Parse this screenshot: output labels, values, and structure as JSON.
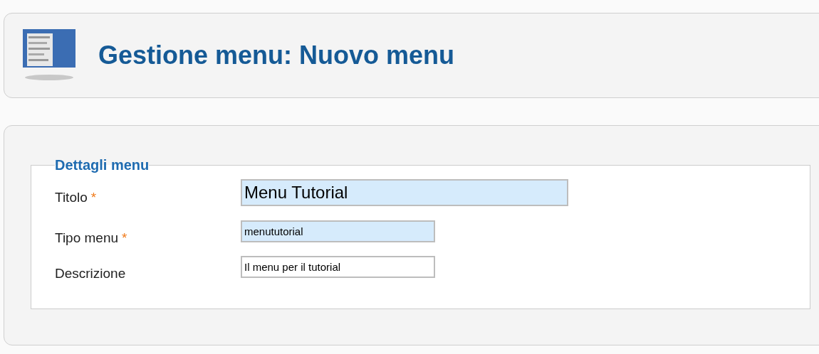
{
  "header": {
    "title": "Gestione menu: Nuovo menu"
  },
  "fieldset": {
    "legend": "Dettagli menu",
    "fields": [
      {
        "label": "Titolo",
        "marker": "*",
        "value": "Menu Tutorial",
        "kind": "large",
        "highlighted": true
      },
      {
        "label": "Tipo menu",
        "marker": "*",
        "value": "menututorial",
        "kind": "small",
        "highlighted": true
      },
      {
        "label": "Descrizione",
        "value": "Il menu per il tutorial",
        "kind": "small",
        "highlighted": false
      }
    ]
  }
}
